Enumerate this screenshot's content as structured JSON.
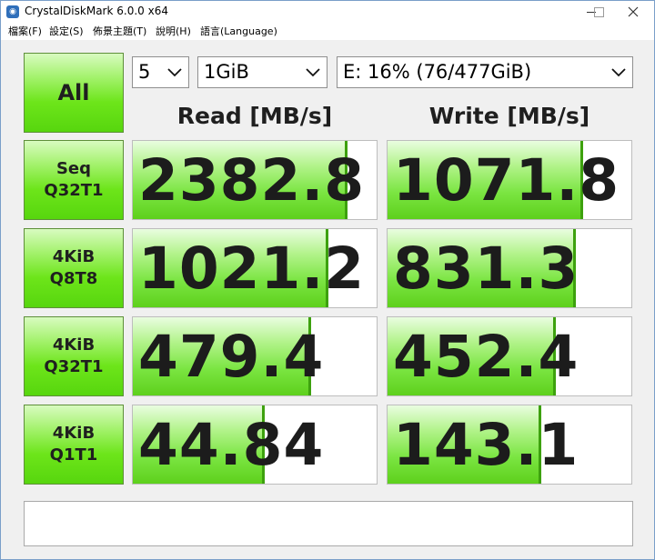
{
  "window": {
    "title": "CrystalDiskMark 6.0.0 x64",
    "icon": "crystaldiskmark-app-icon"
  },
  "menu": [
    "檔案(F)",
    "設定(S)",
    "佈景主題(T)",
    "說明(H)",
    "語言(Language)"
  ],
  "controls": {
    "all_label": "All",
    "test_count": "5",
    "test_size": "1GiB",
    "drive": "E: 16% (76/477GiB)"
  },
  "headers": {
    "read": "Read [MB/s]",
    "write": "Write [MB/s]"
  },
  "tests": [
    {
      "line1": "Seq",
      "line2": "Q32T1",
      "read": "2382.8",
      "write": "1071.8",
      "read_fill": 0.87,
      "write_fill": 0.79
    },
    {
      "line1": "4KiB",
      "line2": "Q8T8",
      "read": "1021.2",
      "write": "831.3",
      "read_fill": 0.79,
      "write_fill": 0.76
    },
    {
      "line1": "4KiB",
      "line2": "Q32T1",
      "read": "479.4",
      "write": "452.4",
      "read_fill": 0.72,
      "write_fill": 0.68
    },
    {
      "line1": "4KiB",
      "line2": "Q1T1",
      "read": "44.84",
      "write": "143.1",
      "read_fill": 0.53,
      "write_fill": 0.62
    }
  ],
  "comment": "",
  "colors": {
    "green": "#6de51a",
    "bar_edge": "#3da10e",
    "background": "#f0f0f0"
  }
}
